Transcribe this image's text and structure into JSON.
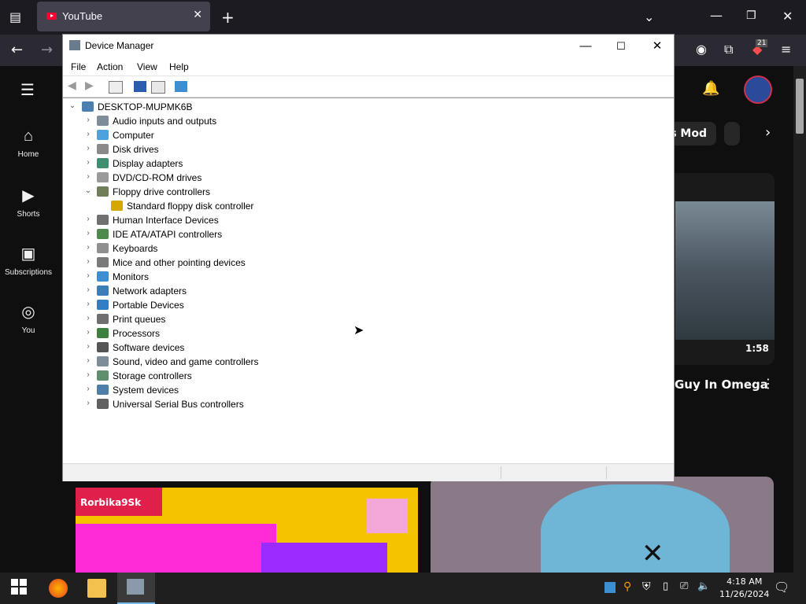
{
  "browser": {
    "tab_title": "YouTube",
    "new_tab": "+",
    "tab_close": "✕"
  },
  "youtube": {
    "sidebar": [
      {
        "icon": "home-icon",
        "label": "Home"
      },
      {
        "icon": "shorts-icon",
        "label": "Shorts"
      },
      {
        "icon": "subscriptions-icon",
        "label": "Subscriptions"
      },
      {
        "icon": "you-icon",
        "label": "You"
      }
    ],
    "chip_partial": "s Mod",
    "video_duration": "1:58",
    "video_title_partial": "Guy In Omega",
    "notification_count": "21",
    "thumb_text_left": "Rorbika9Sk"
  },
  "device_manager": {
    "title": "Device Manager",
    "menu": [
      "File",
      "Action",
      "View",
      "Help"
    ],
    "root": "DESKTOP-MUPMK6B",
    "items": [
      {
        "label": "Audio inputs and outputs",
        "expanded": false,
        "color": "#7f8c9a"
      },
      {
        "label": "Computer",
        "expanded": false,
        "color": "#4aa3df"
      },
      {
        "label": "Disk drives",
        "expanded": false,
        "color": "#8a8a8a"
      },
      {
        "label": "Display adapters",
        "expanded": false,
        "color": "#3f8f6e"
      },
      {
        "label": "DVD/CD-ROM drives",
        "expanded": false,
        "color": "#9a9a9a"
      },
      {
        "label": "Floppy drive controllers",
        "expanded": true,
        "color": "#6f7f5a"
      },
      {
        "label": "Standard floppy disk controller",
        "child": true,
        "color": "#d4a800"
      },
      {
        "label": "Human Interface Devices",
        "expanded": false,
        "color": "#707070"
      },
      {
        "label": "IDE ATA/ATAPI controllers",
        "expanded": false,
        "color": "#4e8a4e"
      },
      {
        "label": "Keyboards",
        "expanded": false,
        "color": "#8f8f8f"
      },
      {
        "label": "Mice and other pointing devices",
        "expanded": false,
        "color": "#7a7a7a"
      },
      {
        "label": "Monitors",
        "expanded": false,
        "color": "#3d8fd1"
      },
      {
        "label": "Network adapters",
        "expanded": false,
        "color": "#3c7fb8"
      },
      {
        "label": "Portable Devices",
        "expanded": false,
        "color": "#2f7fc7"
      },
      {
        "label": "Print queues",
        "expanded": false,
        "color": "#6f6f6f"
      },
      {
        "label": "Processors",
        "expanded": false,
        "color": "#3f7f3f"
      },
      {
        "label": "Software devices",
        "expanded": false,
        "color": "#555555"
      },
      {
        "label": "Sound, video and game controllers",
        "expanded": false,
        "color": "#7f8c9a"
      },
      {
        "label": "Storage controllers",
        "expanded": false,
        "color": "#5f8f6f"
      },
      {
        "label": "System devices",
        "expanded": false,
        "color": "#4f7fa8"
      },
      {
        "label": "Universal Serial Bus controllers",
        "expanded": false,
        "color": "#606060"
      }
    ]
  },
  "taskbar": {
    "time": "4:18 AM",
    "date": "11/26/2024"
  }
}
